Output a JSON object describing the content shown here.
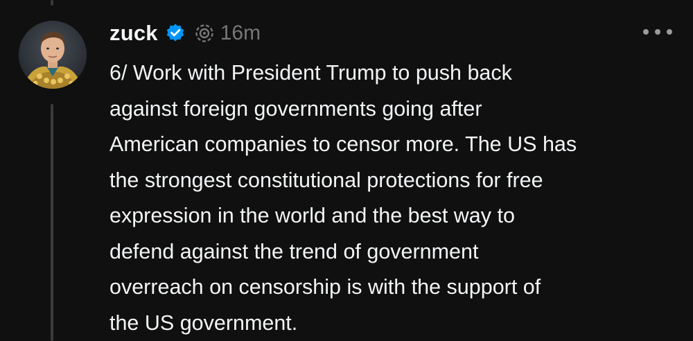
{
  "post": {
    "author": {
      "username": "zuck",
      "verified": true,
      "avatar_icon": "profile-photo"
    },
    "timestamp": "16m",
    "icons": {
      "verified": "verified-badge-icon",
      "ai": "ai-label-icon",
      "more": "more-options-icon"
    },
    "text": "6/ Work with President Trump to push back\nagainst foreign governments going after\nAmerican companies to censor more. The US has\nthe strongest constitutional protections for free\nexpression in the world and the best way to\ndefend against the trend of government\noverreach on censorship is with the support of\nthe US government."
  },
  "colors": {
    "background": "#101010",
    "text_primary": "#f3f5f7",
    "text_secondary": "#777777",
    "verified_blue": "#0095f6",
    "thread_line": "#3a3a3a"
  }
}
